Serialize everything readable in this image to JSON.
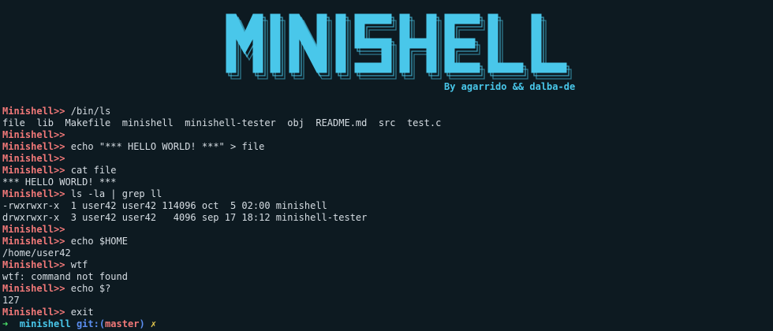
{
  "banner": {
    "title": "MINISHELL",
    "byline": "By agarrido && dalba-de",
    "color": "#49c7ea"
  },
  "prompt_label": "Minishell>>",
  "lines": [
    {
      "type": "prompt",
      "cmd": "/bin/ls"
    },
    {
      "type": "out",
      "text": "file  lib  Makefile  minishell  minishell-tester  obj  README.md  src  test.c"
    },
    {
      "type": "prompt",
      "cmd": ""
    },
    {
      "type": "prompt",
      "cmd": "echo \"*** HELLO WORLD! ***\" > file"
    },
    {
      "type": "prompt",
      "cmd": ""
    },
    {
      "type": "prompt",
      "cmd": "cat file"
    },
    {
      "type": "out",
      "text": "*** HELLO WORLD! ***"
    },
    {
      "type": "prompt",
      "cmd": "ls -la | grep ll"
    },
    {
      "type": "out",
      "text": "-rwxrwxr-x  1 user42 user42 114096 oct  5 02:00 minishell"
    },
    {
      "type": "out",
      "text": "drwxrwxr-x  3 user42 user42   4096 sep 17 18:12 minishell-tester"
    },
    {
      "type": "prompt",
      "cmd": ""
    },
    {
      "type": "prompt",
      "cmd": "echo $HOME"
    },
    {
      "type": "out",
      "text": "/home/user42"
    },
    {
      "type": "prompt",
      "cmd": "wtf"
    },
    {
      "type": "out",
      "text": "wtf: command not found"
    },
    {
      "type": "prompt",
      "cmd": "echo $?"
    },
    {
      "type": "out",
      "text": "127"
    },
    {
      "type": "prompt",
      "cmd": "exit"
    }
  ],
  "zsh_prompt": {
    "arrow": "➜",
    "dir": "minishell",
    "git_prefix": "git:(",
    "branch": "master",
    "git_suffix": ")",
    "dirty": "✗"
  },
  "colors": {
    "background": "#0d1a21",
    "prompt": "#f07878",
    "text": "#d6dde3",
    "accent": "#49c7ea",
    "zsh_arrow": "#4be36a",
    "zsh_git": "#5b8ef0",
    "zsh_dirty": "#f0d050"
  }
}
